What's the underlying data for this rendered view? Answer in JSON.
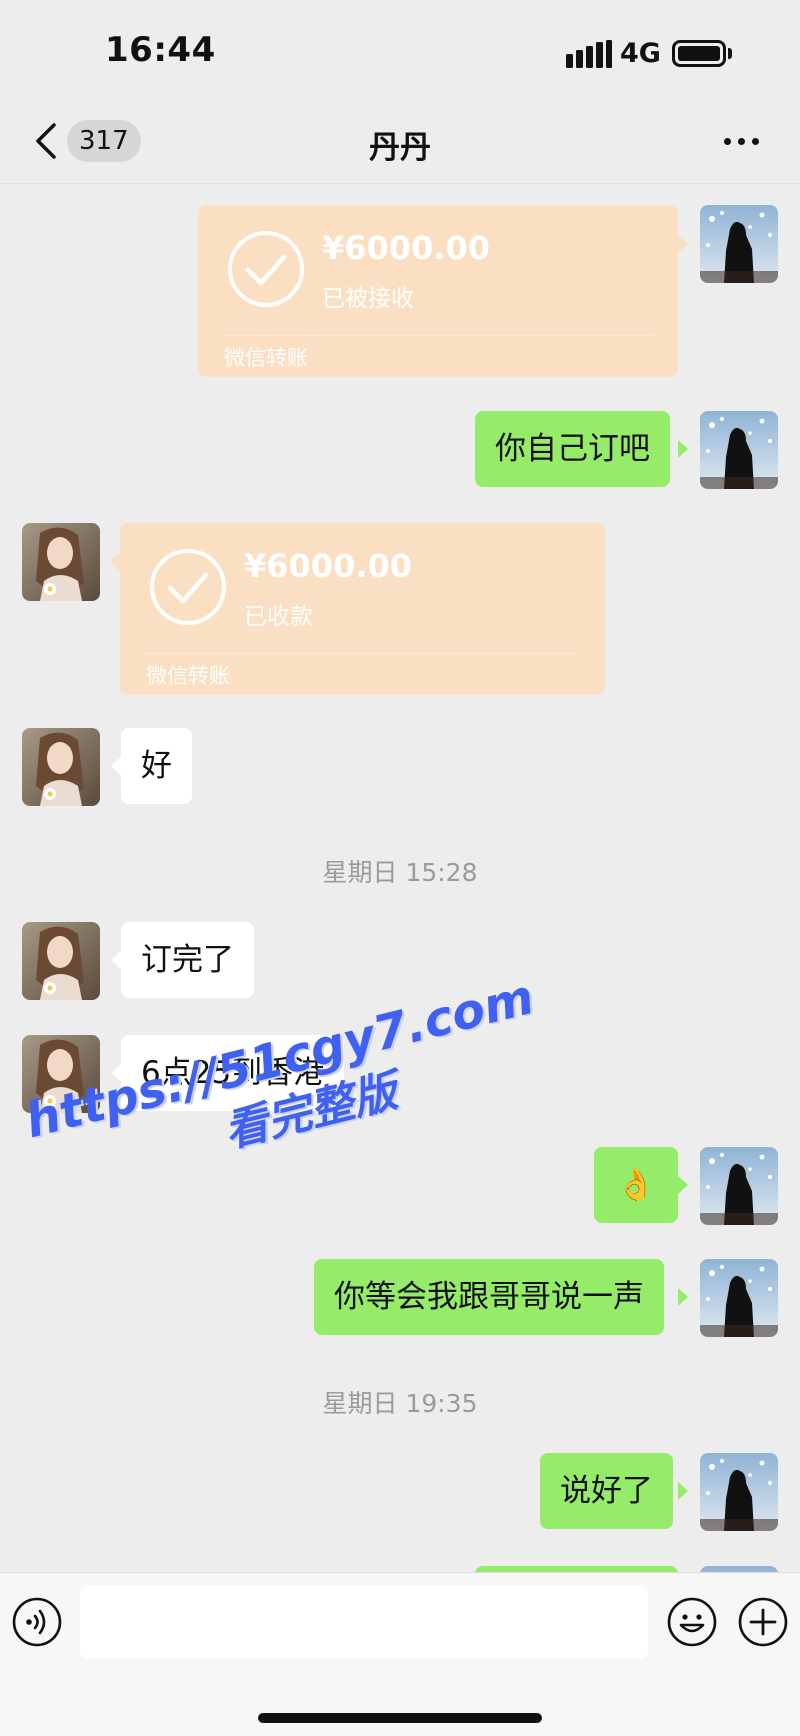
{
  "status_bar": {
    "time": "16:44",
    "network": "4G"
  },
  "header": {
    "unread_count": "317",
    "title": "丹丹"
  },
  "messages": [
    {
      "type": "transfer",
      "side": "me",
      "amount": "¥6000.00",
      "status": "已被接收",
      "label": "微信转账"
    },
    {
      "type": "text",
      "side": "me",
      "text": "你自己订吧"
    },
    {
      "type": "transfer",
      "side": "other",
      "amount": "¥6000.00",
      "status": "已收款",
      "label": "微信转账"
    },
    {
      "type": "text",
      "side": "other",
      "text": "好"
    },
    {
      "type": "timestamp",
      "text": "星期日 15:28"
    },
    {
      "type": "text",
      "side": "other",
      "text": "订完了"
    },
    {
      "type": "text",
      "side": "other",
      "text": "6点25到香港"
    },
    {
      "type": "text",
      "side": "me",
      "text": "👌"
    },
    {
      "type": "text",
      "side": "me",
      "text": "你等会我跟哥哥说一声"
    },
    {
      "type": "timestamp",
      "text": "星期日 19:35"
    },
    {
      "type": "text",
      "side": "me",
      "text": "说好了"
    }
  ],
  "watermark": {
    "url": "https://51cgy7.com",
    "subtitle": "看完整版"
  },
  "input_bar": {
    "placeholder": "",
    "value": ""
  },
  "icons": {
    "back": "chevron-left-icon",
    "more": "more-dots-icon",
    "voice": "voice-icon",
    "emoji": "emoji-icon",
    "plus": "plus-icon",
    "check": "check-circle-icon"
  },
  "colors": {
    "my_bubble": "#95ec69",
    "their_bubble": "#ffffff",
    "transfer_card": "#fbdfc3",
    "background": "#ededed",
    "watermark": "#4060f0"
  }
}
